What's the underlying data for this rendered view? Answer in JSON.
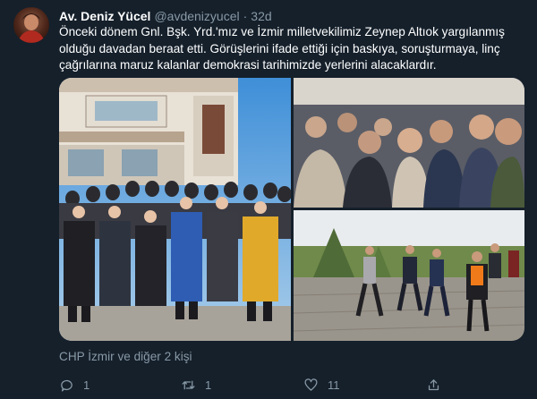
{
  "tweet": {
    "author_name": "Av. Deniz Yücel",
    "author_handle": "@avdenizyucel",
    "separator": "·",
    "time": "32d",
    "text": "Önceki dönem Gnl. Bşk. Yrd.'mız ve İzmir milletvekilimiz Zeynep Altıok yargılanmış olduğu davadan beraat etti. Görüşlerini ifade ettiği için baskıya, soruşturmaya, linç çağrılarına maruz kalanlar demokrasi tarihimizde yerlerini alacaklardır.",
    "tagged": "CHP İzmir ve diğer 2 kişi"
  },
  "actions": {
    "reply_count": "1",
    "retweet_count": "1",
    "like_count": "11",
    "reply_icon": "reply-icon",
    "retweet_icon": "retweet-icon",
    "like_icon": "heart-icon",
    "share_icon": "share-icon"
  },
  "colors": {
    "background": "#15202b",
    "text": "#ffffff",
    "secondary": "#8899a6"
  }
}
